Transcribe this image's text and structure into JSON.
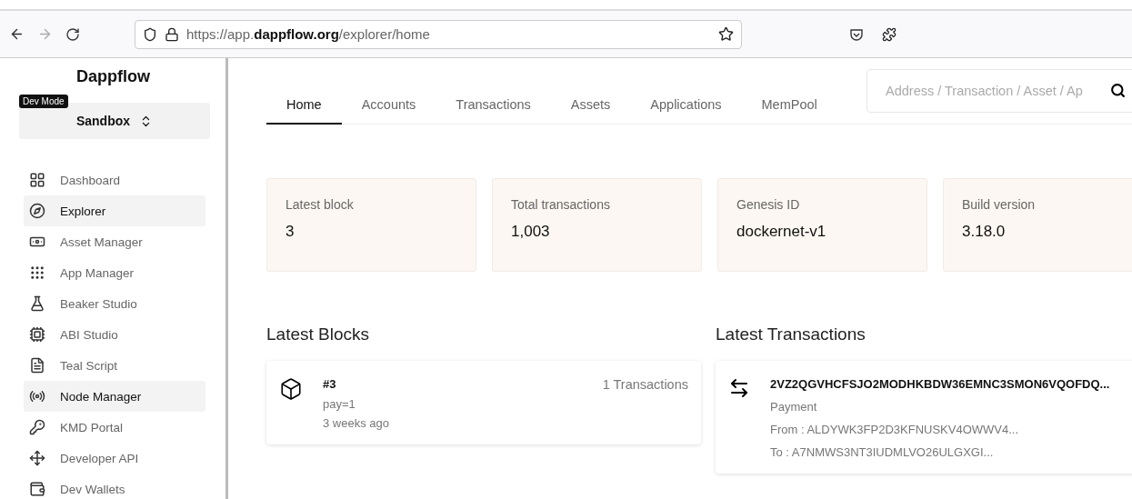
{
  "browser": {
    "url": "https://app.**dappflow.org**/explorer/home"
  },
  "sidebar": {
    "logo": "Dappflow",
    "badge": "Dev Mode",
    "network": "Sandbox",
    "items": [
      {
        "label": "Dashboard",
        "selected": false
      },
      {
        "label": "Explorer",
        "selected": true
      },
      {
        "label": "Asset Manager",
        "selected": false
      },
      {
        "label": "App Manager",
        "selected": false
      },
      {
        "label": "Beaker Studio",
        "selected": false
      },
      {
        "label": "ABI Studio",
        "selected": false
      },
      {
        "label": "Teal Script",
        "selected": false
      },
      {
        "label": "Node Manager",
        "selected": true
      },
      {
        "label": "KMD Portal",
        "selected": false
      },
      {
        "label": "Developer API",
        "selected": false
      },
      {
        "label": "Dev Wallets",
        "selected": false
      }
    ]
  },
  "tabs": [
    {
      "label": "Home",
      "selected": true
    },
    {
      "label": "Accounts",
      "selected": false
    },
    {
      "label": "Transactions",
      "selected": false
    },
    {
      "label": "Assets",
      "selected": false
    },
    {
      "label": "Applications",
      "selected": false
    },
    {
      "label": "MemPool",
      "selected": false
    }
  ],
  "search": {
    "placeholder": "Address / Transaction / Asset / Ap"
  },
  "stats": [
    {
      "label": "Latest block",
      "value": "3"
    },
    {
      "label": "Total transactions",
      "value": "1,003"
    },
    {
      "label": "Genesis ID",
      "value": "dockernet-v1"
    },
    {
      "label": "Build version",
      "value": "3.18.0"
    }
  ],
  "latest_blocks": {
    "title": "Latest Blocks",
    "items": [
      {
        "number": "#3",
        "summary": "pay=1",
        "age": "3 weeks ago",
        "transactions": "1 Transactions"
      }
    ]
  },
  "latest_transactions": {
    "title": "Latest Transactions",
    "items": [
      {
        "id": "2VZ2QGVHCFSJO2MODHKBDW36EMNC3SMON6VQOFDQ...",
        "type": "Payment",
        "from": "From : ALDYWK3FP2D3KFNUSKV4OWWV4...",
        "to": "To : A7NMWS3NT3IUDMLVO26ULGXGI..."
      }
    ]
  }
}
